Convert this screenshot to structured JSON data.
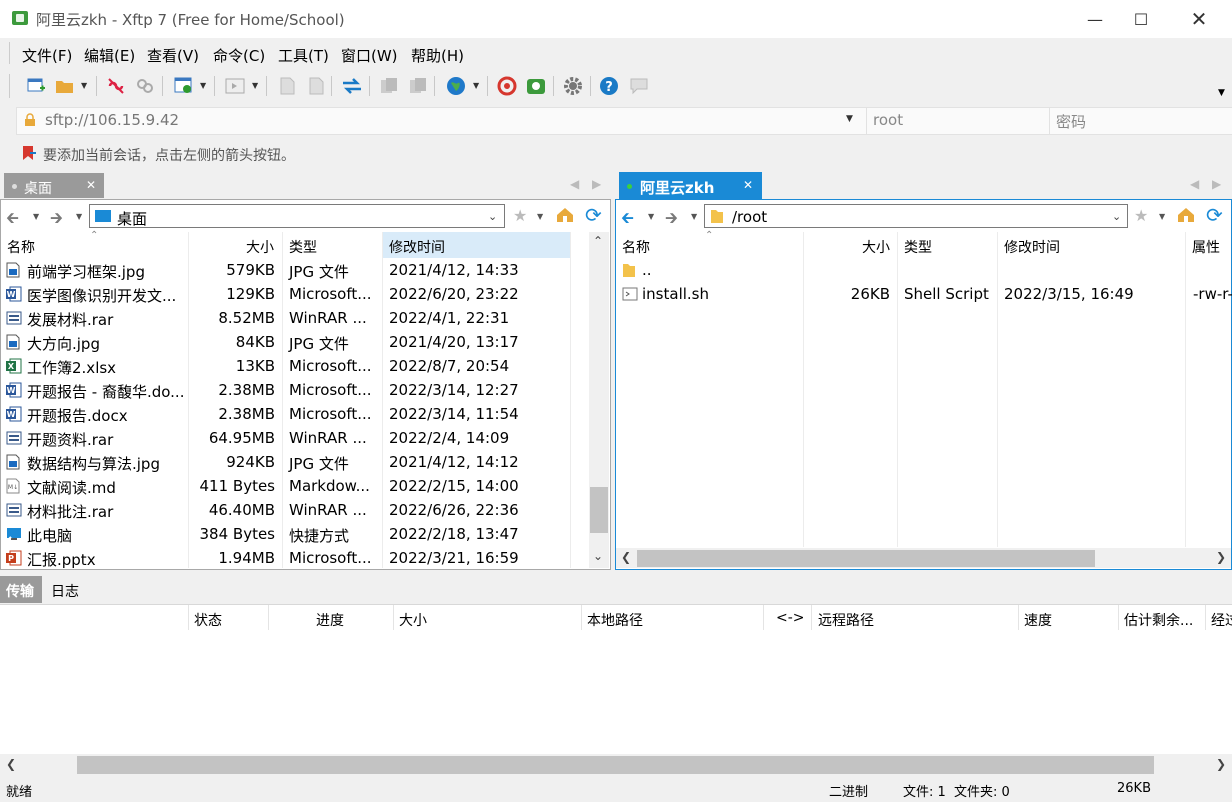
{
  "window": {
    "title": "阿里云zkh - Xftp 7 (Free for Home/School)"
  },
  "menu": [
    "文件(F)",
    "编辑(E)",
    "查看(V)",
    "命令(C)",
    "工具(T)",
    "窗口(W)",
    "帮助(H)"
  ],
  "address": {
    "host": "sftp://106.15.9.42",
    "user_placeholder": "root",
    "password_placeholder": "密码"
  },
  "hint": "要添加当前会话，点击左侧的箭头按钮。",
  "left": {
    "tab": "桌面",
    "path": "桌面",
    "columns": {
      "name": "名称",
      "size": "大小",
      "type": "类型",
      "modified": "修改时间"
    },
    "files": [
      {
        "name": "前端学习框架.jpg",
        "size": "579KB",
        "type": "JPG 文件",
        "modified": "2021/4/12, 14:33",
        "icon": "image-file-icon"
      },
      {
        "name": "医学图像识别开发文...",
        "size": "129KB",
        "type": "Microsoft...",
        "modified": "2022/6/20, 23:22",
        "icon": "word-file-icon"
      },
      {
        "name": "发展材料.rar",
        "size": "8.52MB",
        "type": "WinRAR ...",
        "modified": "2022/4/1, 22:31",
        "icon": "rar-file-icon"
      },
      {
        "name": "大方向.jpg",
        "size": "84KB",
        "type": "JPG 文件",
        "modified": "2021/4/20, 13:17",
        "icon": "image-file-icon"
      },
      {
        "name": "工作簿2.xlsx",
        "size": "13KB",
        "type": "Microsoft...",
        "modified": "2022/8/7, 20:54",
        "icon": "excel-file-icon"
      },
      {
        "name": "开题报告 - 裔馥华.do...",
        "size": "2.38MB",
        "type": "Microsoft...",
        "modified": "2022/3/14, 12:27",
        "icon": "word-file-icon"
      },
      {
        "name": "开题报告.docx",
        "size": "2.38MB",
        "type": "Microsoft...",
        "modified": "2022/3/14, 11:54",
        "icon": "word-file-icon"
      },
      {
        "name": "开题资料.rar",
        "size": "64.95MB",
        "type": "WinRAR ...",
        "modified": "2022/2/4, 14:09",
        "icon": "rar-file-icon"
      },
      {
        "name": "数据结构与算法.jpg",
        "size": "924KB",
        "type": "JPG 文件",
        "modified": "2021/4/12, 14:12",
        "icon": "image-file-icon"
      },
      {
        "name": "文献阅读.md",
        "size": "411 Bytes",
        "type": "Markdow...",
        "modified": "2022/2/15, 14:00",
        "icon": "markdown-file-icon"
      },
      {
        "name": "材料批注.rar",
        "size": "46.40MB",
        "type": "WinRAR ...",
        "modified": "2022/6/26, 22:36",
        "icon": "rar-file-icon"
      },
      {
        "name": "此电脑",
        "size": "384 Bytes",
        "type": "快捷方式",
        "modified": "2022/2/18, 13:47",
        "icon": "shortcut-icon"
      },
      {
        "name": "汇报.pptx",
        "size": "1.94MB",
        "type": "Microsoft...",
        "modified": "2022/3/21, 16:59",
        "icon": "powerpoint-file-icon"
      }
    ]
  },
  "right": {
    "tab": "阿里云zkh",
    "path": "/root",
    "columns": {
      "name": "名称",
      "size": "大小",
      "type": "类型",
      "modified": "修改时间",
      "attr": "属性"
    },
    "files": [
      {
        "name": "..",
        "size": "",
        "type": "",
        "modified": "",
        "attr": "",
        "icon": "folder-icon"
      },
      {
        "name": "install.sh",
        "size": "26KB",
        "type": "Shell Script",
        "modified": "2022/3/15, 16:49",
        "attr": "-rw-r-",
        "icon": "script-file-icon"
      }
    ]
  },
  "bottom": {
    "tabs": [
      "传输",
      "日志"
    ],
    "columns": [
      "状态",
      "进度",
      "大小",
      "本地路径",
      "<->",
      "远程路径",
      "速度",
      "估计剩余...",
      "经过"
    ]
  },
  "status": {
    "left": "就绪",
    "mode": "二进制",
    "counts": "文件: 1  文件夹: 0",
    "size": "26KB"
  },
  "colors": {
    "accent": "#1a8ad6",
    "tab_inactive": "#9a9a9a"
  }
}
